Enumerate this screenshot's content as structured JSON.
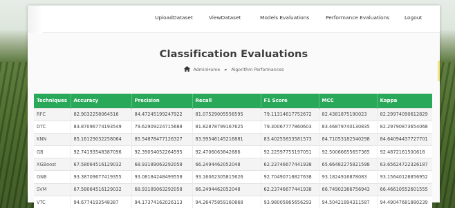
{
  "nav": {
    "items": [
      {
        "label": "UploadDataset"
      },
      {
        "label": "ViewDataset"
      },
      {
        "label": "Models Evaluations"
      },
      {
        "label": "Performance Evaluations"
      },
      {
        "label": "Logout"
      }
    ]
  },
  "page": {
    "title": "Classification Evaluations",
    "breadcrumb": {
      "home_icon": "home-icon",
      "home": "AdminHome",
      "separator": "»",
      "current": "Algorithm Performances"
    }
  },
  "colors": {
    "header_bg": "#2aa85a",
    "header_text": "#ffffff"
  },
  "table": {
    "columns": [
      "Techniques",
      "Accuracy",
      "Precision",
      "Recall",
      "F1 Score",
      "MCC",
      "Kappa"
    ],
    "rows": [
      [
        "RFC",
        "82.9032258064516",
        "84.47245199247922",
        "81.07529005556595",
        "79.11314617752672",
        "82.4381875190023",
        "82.29974090612829"
      ],
      [
        "DTC",
        "83.87096774193549",
        "79.62909224715688",
        "81.82878799167625",
        "79.30067777860603",
        "83.46879740130835",
        "82.29790873654068"
      ],
      [
        "KNN",
        "85.16129032258064",
        "85.54878477126327",
        "83.99546145216881",
        "83.40255833581573",
        "84.71053182540298",
        "84.64094437727701"
      ],
      [
        "GB",
        "92.74193548387096",
        "92.39054052264595",
        "92.4706063842686",
        "92.22597755197051",
        "92.50066655657365",
        "92.4872161500618"
      ],
      [
        "XGBoost",
        "67.58064516129032",
        "68.93189063292058",
        "66.2494462052048",
        "62.23746677441938",
        "65.66482275821598",
        "63.65624722326187"
      ],
      [
        "GNB",
        "93.38709677419355",
        "93.08184248499558",
        "93.16062305815626",
        "92.70490718827638",
        "93.1824916878083",
        "93.15640126856952"
      ],
      [
        "SVM",
        "67.58064516129032",
        "68.93189063292058",
        "66.2494462052048",
        "62.23746677441938",
        "66.74902366756943",
        "66.46610552601555"
      ],
      [
        "VTC",
        "94.6774193548387",
        "94.17374162026113",
        "94.26475859160868",
        "93.98005865656293",
        "94.50421894311587",
        "94.49047681880239"
      ]
    ]
  }
}
